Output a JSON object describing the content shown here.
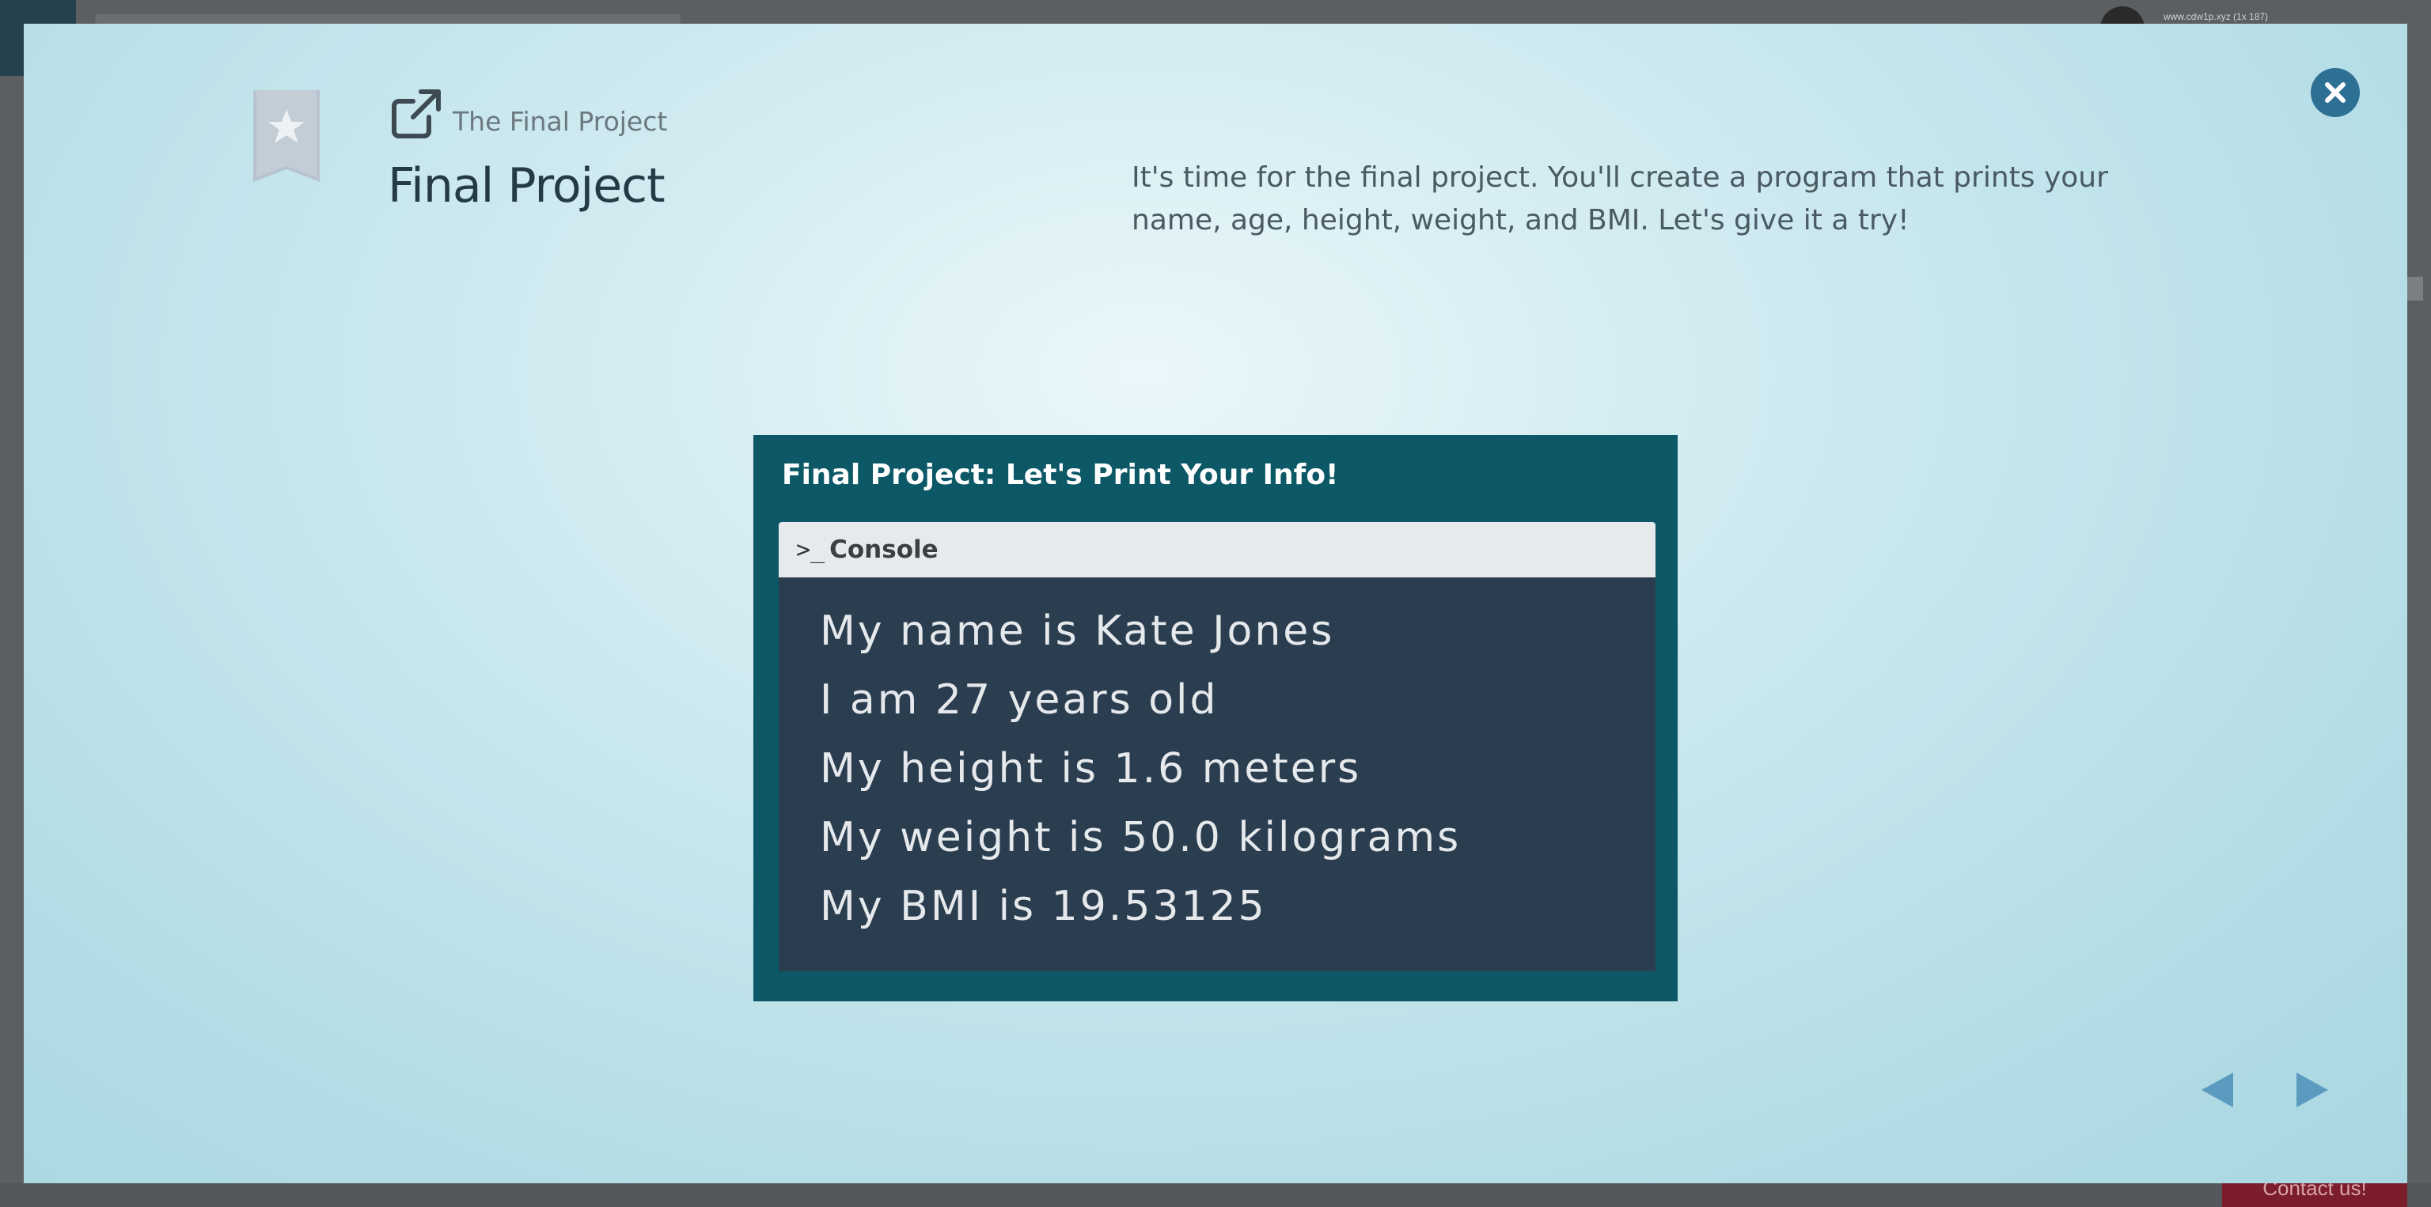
{
  "background": {
    "url_text": "www.cdw1p.xyz (1x 187)",
    "contact_label": "Contact us!"
  },
  "modal": {
    "subtitle": "The Final Project",
    "title": "Final Project",
    "description": "It's time for the final project. You'll create a program that prints your name, age, height, weight, and BMI. Let's give it a try!",
    "icons": {
      "bookmark": "bookmark-star-icon",
      "external": "external-link-icon",
      "close": "close-icon",
      "prev": "prev-arrow-icon",
      "next": "next-arrow-icon"
    },
    "colors": {
      "accent": "#2e6f94",
      "slide_bg": "#0c5866",
      "console_bg": "#2b3e50",
      "arrow": "#5b9bc0"
    }
  },
  "slide": {
    "title": "Final Project: Let's Print Your Info!",
    "console": {
      "prompt": ">_",
      "label": "Console",
      "lines": [
        "My name is Kate Jones",
        "I am 27 years old",
        "My height is 1.6 meters",
        "My weight is 50.0 kilograms",
        "My BMI is 19.53125"
      ]
    }
  }
}
